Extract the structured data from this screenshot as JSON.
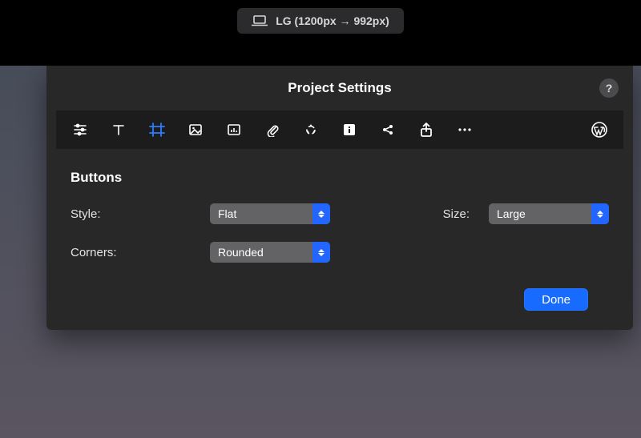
{
  "breakpoint": {
    "label": "LG (1200px → 992px)"
  },
  "panel": {
    "title": "Project Settings",
    "help_glyph": "?"
  },
  "toolbar": {
    "icons": [
      {
        "name": "sliders-icon",
        "active": false
      },
      {
        "name": "type-icon",
        "active": false
      },
      {
        "name": "frame-icon",
        "active": true
      },
      {
        "name": "image-icon",
        "active": false
      },
      {
        "name": "chart-icon",
        "active": false
      },
      {
        "name": "paperclip-icon",
        "active": false
      },
      {
        "name": "recycle-icon",
        "active": false
      },
      {
        "name": "info-icon",
        "active": false
      },
      {
        "name": "share-icon",
        "active": false
      },
      {
        "name": "upload-icon",
        "active": false
      },
      {
        "name": "more-icon",
        "active": false
      },
      {
        "name": "wordpress-icon",
        "active": false
      }
    ]
  },
  "section": {
    "title": "Buttons",
    "style_label": "Style:",
    "style_value": "Flat",
    "size_label": "Size:",
    "size_value": "Large",
    "corners_label": "Corners:",
    "corners_value": "Rounded"
  },
  "footer": {
    "done_label": "Done"
  }
}
